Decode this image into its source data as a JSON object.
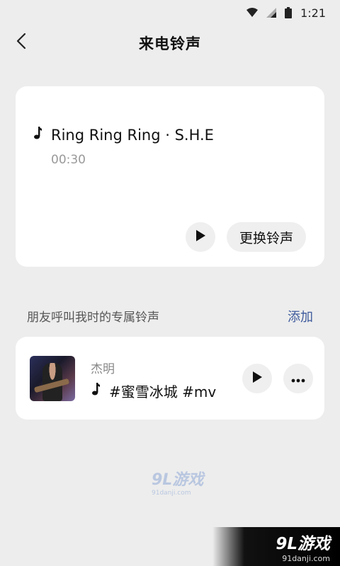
{
  "status_bar": {
    "time": "1:21",
    "icons": [
      "wifi-icon",
      "signal-icon",
      "battery-icon"
    ]
  },
  "header": {
    "title": "来电铃声",
    "back_icon": "chevron-left-icon"
  },
  "current_ringtone": {
    "song": "Ring Ring Ring · S.H.E",
    "duration": "00:30",
    "change_label": "更换铃声"
  },
  "friends_section": {
    "label": "朋友呼叫我时的专属铃声",
    "add_label": "添加",
    "items": [
      {
        "contact": "杰明",
        "song": "#蜜雪冰城 #mv"
      }
    ]
  },
  "watermark": {
    "logo": "9L游戏",
    "url": "91danji.com"
  },
  "corner_logo": {
    "logo": "9L游戏",
    "url": "91danji.com"
  },
  "colors": {
    "background": "#ededed",
    "card": "#ffffff",
    "accent_link": "#3d5a9c"
  }
}
